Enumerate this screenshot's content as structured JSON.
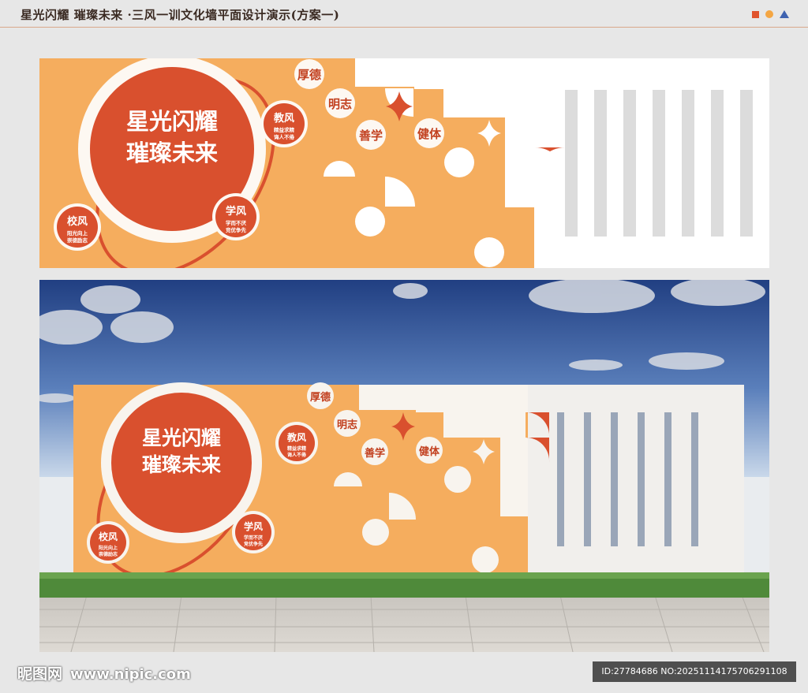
{
  "header": {
    "title": "星光闪耀 璀璨未来 ·三风一训文化墙平面设计演示(方案一)"
  },
  "wall": {
    "slogan_line1": "星光闪耀",
    "slogan_line2": "璀璨未来",
    "tags": [
      "厚德",
      "明志",
      "善学",
      "健体"
    ],
    "jiaofeng_title": "教风",
    "jiaofeng_l1": "精益求精",
    "jiaofeng_l2": "诲人不倦",
    "xiaofeng_title": "校风",
    "xiaofeng_l1": "阳光向上",
    "xiaofeng_l2": "崇德励志",
    "xuefeng_title": "学风",
    "xuefeng_l1": "学而不厌",
    "xuefeng_l2": "竞优争先"
  },
  "colors": {
    "orange": "#f5ad5e",
    "red": "#d9502e",
    "cream": "#fdf8f2",
    "stripe": "#dcdcdc"
  },
  "footer": {
    "brand": "昵图网",
    "url": "www.nipic.com",
    "id_text": "ID:27784686 NO:20251114175706291108"
  }
}
